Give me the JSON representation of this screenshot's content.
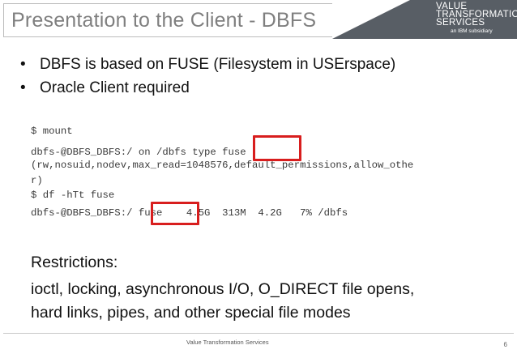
{
  "slide": {
    "title": "Presentation to the Client - DBFS",
    "brand": {
      "line1": "VALUE",
      "line2": "TRANSFORMATION",
      "line3": "SERVICES",
      "tagline": "an IBM subsidiary"
    },
    "bullets": [
      "DBFS is based on FUSE (Filesystem in USErspace)",
      "Oracle Client required"
    ],
    "bullet_glyph": "•",
    "code_lines": [
      "$ mount",
      "dbfs-@DBFS_DBFS:/ on /dbfs type fuse",
      "(rw,nosuid,nodev,max_read=1048576,default_permissions,allow_othe",
      "r)",
      "$ df -hTt fuse",
      "dbfs-@DBFS_DBFS:/ fuse    4.5G  313M  4.2G   7% /dbfs"
    ],
    "restrictions": {
      "heading": "Restrictions:",
      "line1": "ioctl, locking, asynchronous I/O, O_DIRECT file opens,",
      "line2": "hard links, pipes, and other special file modes"
    },
    "footer": {
      "center_text": "Value Transformation Services",
      "page_number": "6"
    },
    "colors": {
      "title": "#7f7f7f",
      "brand_background": "#585e65",
      "highlight_box": "#d81e1e"
    }
  }
}
